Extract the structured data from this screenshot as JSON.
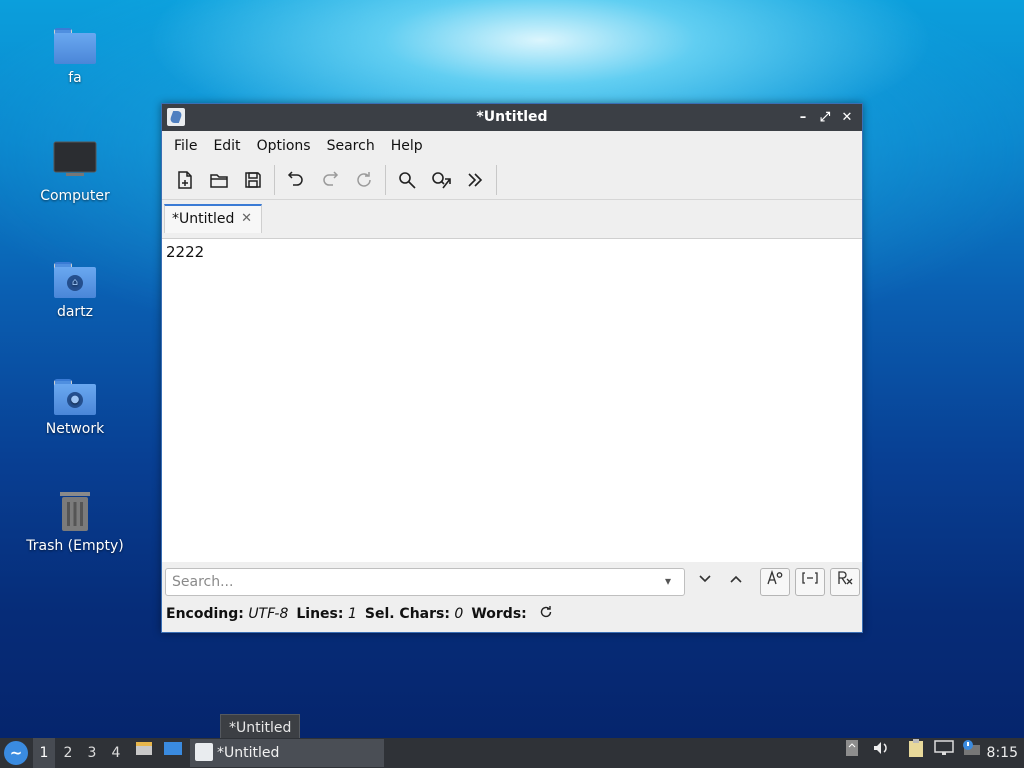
{
  "desktop": {
    "icons": [
      {
        "label": "fa"
      },
      {
        "label": "Computer"
      },
      {
        "label": "dartz"
      },
      {
        "label": "Network"
      },
      {
        "label": "Trash (Empty)"
      }
    ]
  },
  "window": {
    "title": "*Untitled",
    "menu": [
      "File",
      "Edit",
      "Options",
      "Search",
      "Help"
    ],
    "toolbar": [
      "new-document-icon",
      "open-folder-icon",
      "save-icon",
      "undo-icon",
      "redo-icon",
      "reload-icon",
      "find-icon",
      "find-replace-icon",
      "more-icon"
    ],
    "tab": {
      "label": "*Untitled",
      "close": "✕"
    },
    "editor_text": "2222",
    "search": {
      "placeholder": "Search..."
    },
    "status": {
      "encoding_label": "Encoding:",
      "encoding_value": "UTF-8",
      "lines_label": "Lines:",
      "lines_value": "1",
      "sel_label": "Sel. Chars:",
      "sel_value": "0",
      "words_label": "Words:"
    }
  },
  "taskbar": {
    "workspaces": [
      "1",
      "2",
      "3",
      "4"
    ],
    "task_label": "*Untitled",
    "tooltip": "*Untitled",
    "clock": "8:15"
  },
  "colors": {
    "accent": "#3a7bd5",
    "titlebar": "#3b3f45",
    "taskbar": "#2f3237"
  }
}
